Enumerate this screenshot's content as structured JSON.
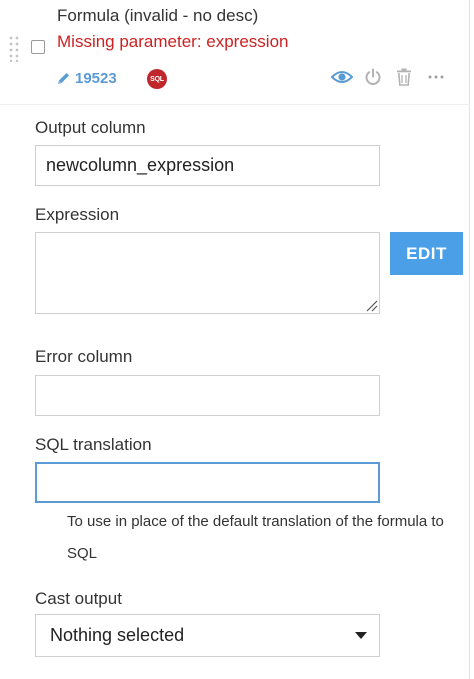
{
  "step": {
    "title": "Formula (invalid - no desc)",
    "error": "Missing parameter: expression",
    "id_label": "19523",
    "engine_badge": "SQL",
    "actions": [
      "eye-icon",
      "power-icon",
      "trash-icon",
      "more-icon"
    ]
  },
  "fields": {
    "output_column": {
      "label": "Output column",
      "value": "newcolumn_expression"
    },
    "expression": {
      "label": "Expression",
      "value": "",
      "edit_label": "EDIT"
    },
    "error_column": {
      "label": "Error column",
      "value": ""
    },
    "sql_translation": {
      "label": "SQL translation",
      "value": "",
      "help": "To use in place of the default translation of the formula to SQL"
    },
    "cast_output": {
      "label": "Cast output",
      "selected": "Nothing selected"
    }
  },
  "colors": {
    "accent": "#4a9fe6",
    "error": "#cc2222",
    "link": "#5a9bd5",
    "sql_badge": "#c0272d"
  }
}
